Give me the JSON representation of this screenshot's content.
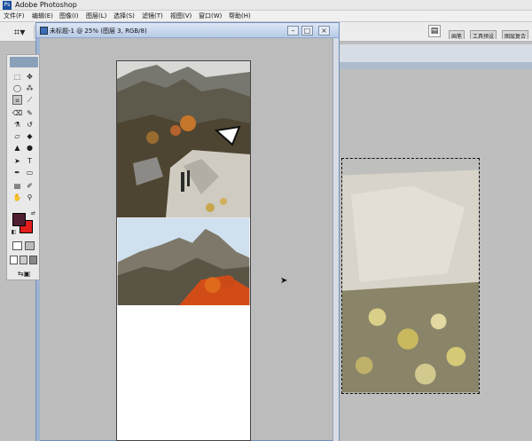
{
  "window": {
    "title": "Adobe Photoshop"
  },
  "menu": [
    "文件(F)",
    "编辑(E)",
    "图像(I)",
    "图层(L)",
    "选择(S)",
    "滤镜(T)",
    "视图(V)",
    "窗口(W)",
    "帮助(H)"
  ],
  "options_bar": {
    "palette_tabs": [
      "画笔",
      "工具预设",
      "图层复合"
    ]
  },
  "document": {
    "title": "未标题-1 @ 25% (图层 3, RGB/8)"
  },
  "colors": {
    "foreground": "#4f1e32",
    "background": "#e41d1d"
  },
  "icons": [
    "photoshop-icon",
    "crop-icon",
    "minimize-icon",
    "maximize-icon",
    "close-icon",
    "mouse-pointer-icon"
  ]
}
